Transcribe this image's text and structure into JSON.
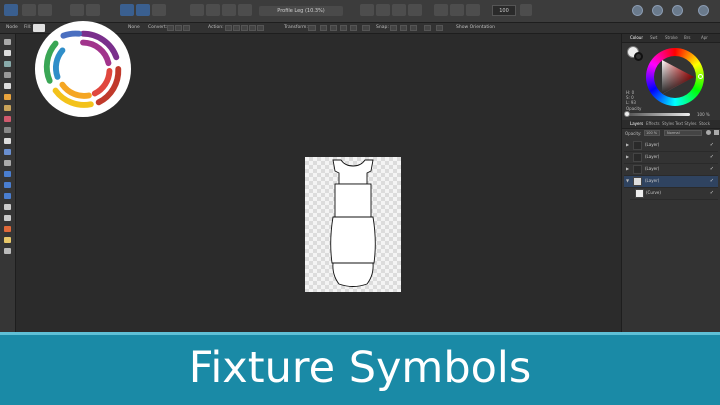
{
  "topbar": {
    "document_name": "Profile Leg (10.3%)",
    "zoom": "100"
  },
  "options_bar": {
    "mode_label": "Node",
    "fill_label": "Fill:",
    "stroke_label": "None",
    "convert_label": "Convert:",
    "action_label": "Action:",
    "transform_label": "Transform:",
    "snap_label": "Snap:",
    "orientation_label": "Show Orientation"
  },
  "color_panel": {
    "tabs": [
      "Colour",
      "Swt",
      "Stroke",
      "Brs",
      "Apr"
    ],
    "h_value": "H: 0",
    "s_value": "S: 0",
    "l_value": "L: 93",
    "opacity_label": "Opacity",
    "opacity_value": "100 %"
  },
  "layers_panel": {
    "tabs": [
      "Layers",
      "Effects",
      "Styles",
      "Text Styles",
      "Stock"
    ],
    "opacity_label": "Opacity:",
    "opacity_value": "100 %",
    "blend_mode": "Normal",
    "layers": [
      {
        "name": "(Layer)",
        "selected": false
      },
      {
        "name": "(Layer)",
        "selected": false
      },
      {
        "name": "(Layer)",
        "selected": false
      },
      {
        "name": "(Layer)",
        "selected": true
      },
      {
        "name": "(Curve)",
        "selected": false
      }
    ]
  },
  "banner": {
    "title": "Fixture Symbols"
  },
  "colors": {
    "banner": "#1a8aa6",
    "selection": "#2f4360",
    "accent": "#4a90d9"
  }
}
